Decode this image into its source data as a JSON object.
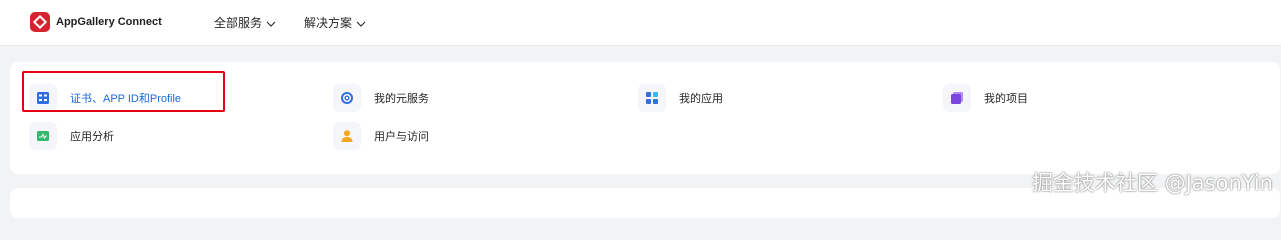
{
  "header": {
    "brand": "AppGallery Connect",
    "nav": [
      {
        "label": "全部服务"
      },
      {
        "label": "解决方案"
      }
    ]
  },
  "services": {
    "items": [
      {
        "label": "证书、APP ID和Profile",
        "icon": "certificate-icon",
        "selected": true
      },
      {
        "label": "我的元服务",
        "icon": "atomic-service-icon"
      },
      {
        "label": "我的应用",
        "icon": "apps-grid-icon"
      },
      {
        "label": "我的项目",
        "icon": "projects-icon"
      },
      {
        "label": "应用分析",
        "icon": "analytics-icon"
      },
      {
        "label": "用户与访问",
        "icon": "user-icon"
      }
    ]
  },
  "watermark": "掘金技术社区 @JasonYin",
  "colors": {
    "brand_red": "#d7232f",
    "accent_blue": "#1a6ad8",
    "highlight_red": "#e60012"
  }
}
